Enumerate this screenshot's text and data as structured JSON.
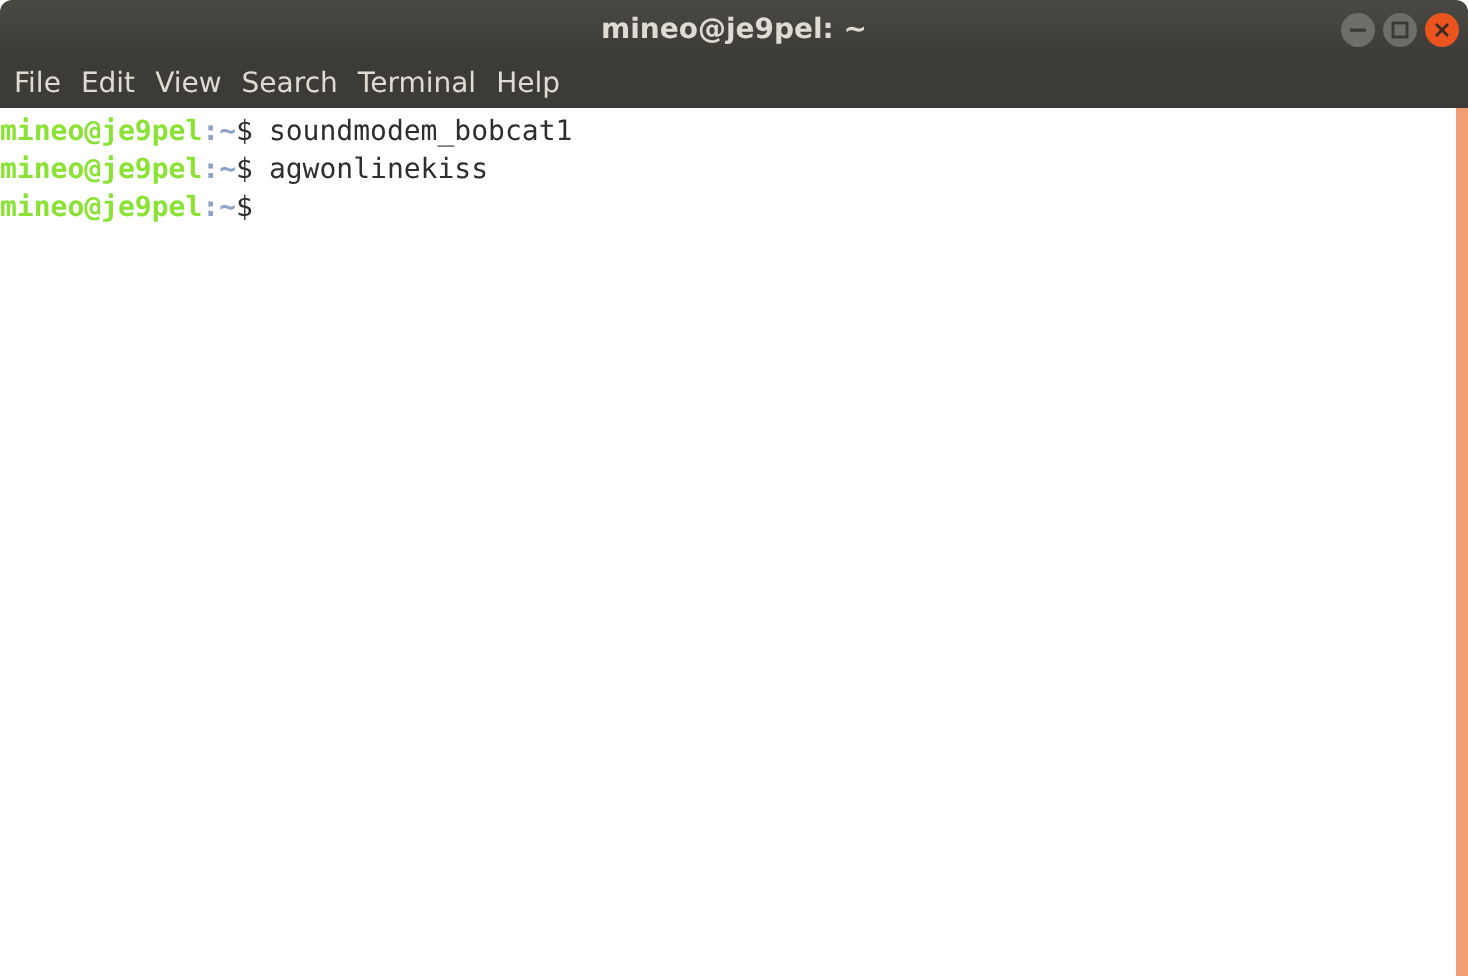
{
  "window": {
    "title": "mineo@je9pel: ~"
  },
  "menu": [
    "File",
    "Edit",
    "View",
    "Search",
    "Terminal",
    "Help"
  ],
  "lines": [
    {
      "user": "mineo@je9pel",
      "path": ":~",
      "symbol": "$",
      "command": "soundmodem_bobcat1"
    },
    {
      "user": "mineo@je9pel",
      "path": ":~",
      "symbol": "$",
      "command": "agwonlinekiss"
    },
    {
      "user": "mineo@je9pel",
      "path": ":~",
      "symbol": "$"
    }
  ]
}
